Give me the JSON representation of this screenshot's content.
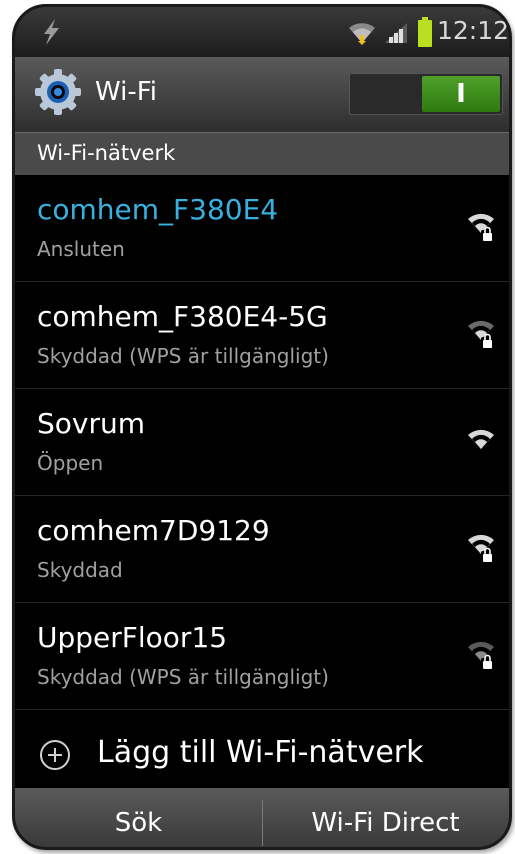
{
  "status_bar": {
    "time": "12:12",
    "icons": [
      "usb-icon",
      "wifi-icon",
      "signal-icon",
      "battery-icon"
    ]
  },
  "header": {
    "title": "Wi-Fi",
    "icon": "settings-icon",
    "toggle_label": "I",
    "toggle_on": true
  },
  "section": {
    "title": "Wi-Fi-nätverk"
  },
  "networks": [
    {
      "name": "comhem_F380E4",
      "status": "Ansluten",
      "secured": true,
      "connected": true
    },
    {
      "name": "comhem_F380E4-5G",
      "status": "Skyddad (WPS är tillgängligt)",
      "secured": true,
      "connected": false
    },
    {
      "name": "Sovrum",
      "status": "Öppen",
      "secured": false,
      "connected": false
    },
    {
      "name": "comhem7D9129",
      "status": "Skyddad",
      "secured": true,
      "connected": false
    },
    {
      "name": "UpperFloor15",
      "status": "Skyddad (WPS är tillgängligt)",
      "secured": true,
      "connected": false
    }
  ],
  "add_network": {
    "label": "Lägg till Wi-Fi-nätverk",
    "icon": "plus-circle-icon"
  },
  "bottom_bar": {
    "search_label": "Sök",
    "direct_label": "Wi-Fi Direct"
  },
  "colors": {
    "connected_accent": "#3ab0e0",
    "toggle_on": "#3e8e1c"
  }
}
